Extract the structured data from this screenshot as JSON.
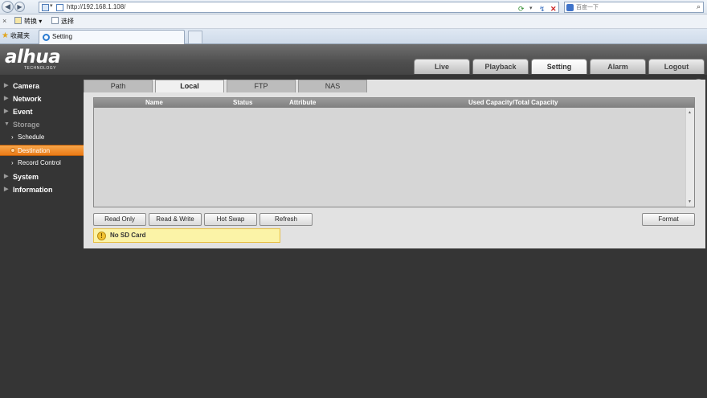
{
  "browser": {
    "url": "http://192.168.1.108/",
    "search_placeholder": "百度一下",
    "commands": [
      {
        "label": "转换"
      },
      {
        "label": "选择"
      }
    ],
    "favorites_label": "收藏夹",
    "tab_title": "Setting"
  },
  "app": {
    "logo": "alhua",
    "logo_sub": "TECHNOLOGY",
    "nav_tabs": [
      {
        "label": "Live",
        "active": false
      },
      {
        "label": "Playback",
        "active": false
      },
      {
        "label": "Setting",
        "active": true
      },
      {
        "label": "Alarm",
        "active": false
      },
      {
        "label": "Logout",
        "active": false
      }
    ]
  },
  "sidebar": {
    "items": [
      {
        "label": "Camera"
      },
      {
        "label": "Network"
      },
      {
        "label": "Event"
      },
      {
        "label": "Storage"
      },
      {
        "label": "System"
      },
      {
        "label": "Information"
      }
    ],
    "storage_subitems": [
      {
        "label": "Schedule",
        "active": false
      },
      {
        "label": "Destination",
        "active": true
      },
      {
        "label": "Record Control",
        "active": false
      }
    ]
  },
  "main": {
    "subtabs": [
      {
        "label": "Path",
        "active": false
      },
      {
        "label": "Local",
        "active": true
      },
      {
        "label": "FTP",
        "active": false
      },
      {
        "label": "NAS",
        "active": false
      }
    ],
    "table": {
      "columns": [
        "Name",
        "Status",
        "Attribute",
        "Used Capacity/Total Capacity"
      ],
      "rows": []
    },
    "buttons": {
      "read_only": "Read Only",
      "read_write": "Read & Write",
      "hot_swap": "Hot Swap",
      "refresh": "Refresh",
      "format": "Format"
    },
    "alert": "No SD Card",
    "help": "?"
  },
  "colors": {
    "accent_orange": "#ee8420",
    "page_background": "#353535",
    "panel_background": "#e2e2e2",
    "alert_background": "#fbf3a7"
  }
}
